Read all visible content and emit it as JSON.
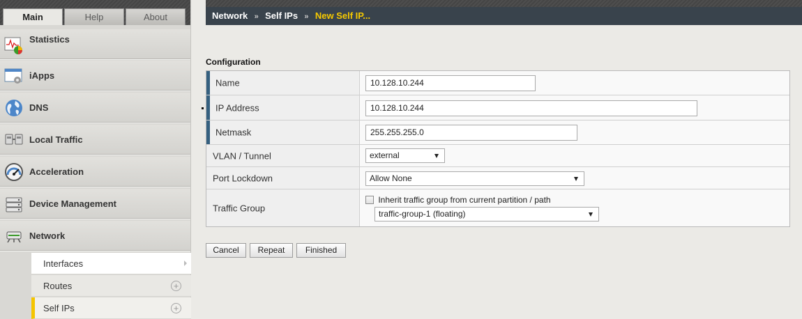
{
  "tabs": {
    "main": "Main",
    "help": "Help",
    "about": "About"
  },
  "nav": {
    "statistics": "Statistics",
    "iapps": "iApps",
    "dns": "DNS",
    "local_traffic": "Local Traffic",
    "acceleration": "Acceleration",
    "device_management": "Device Management",
    "network": "Network"
  },
  "subnav": {
    "interfaces": "Interfaces",
    "routes": "Routes",
    "self_ips": "Self IPs"
  },
  "breadcrumb": {
    "part1": "Network",
    "sep1": "»",
    "part2": "Self IPs",
    "sep2": "»",
    "current": "New Self IP..."
  },
  "form": {
    "section_title": "Configuration",
    "name_label": "Name",
    "name_value": "10.128.10.244",
    "ip_label": "IP Address",
    "ip_value": "10.128.10.244",
    "netmask_label": "Netmask",
    "netmask_value": "255.255.255.0",
    "vlan_label": "VLAN / Tunnel",
    "vlan_value": "external",
    "port_label": "Port Lockdown",
    "port_value": "Allow None",
    "traffic_label": "Traffic Group",
    "inherit_label": "Inherit traffic group from current partition / path",
    "inherit_checked": false,
    "traffic_value": "traffic-group-1 (floating)"
  },
  "buttons": {
    "cancel": "Cancel",
    "repeat": "Repeat",
    "finished": "Finished"
  },
  "colors": {
    "accent_yellow": "#f6c900",
    "required_bar": "#35607f",
    "header_bg": "#39434c"
  }
}
